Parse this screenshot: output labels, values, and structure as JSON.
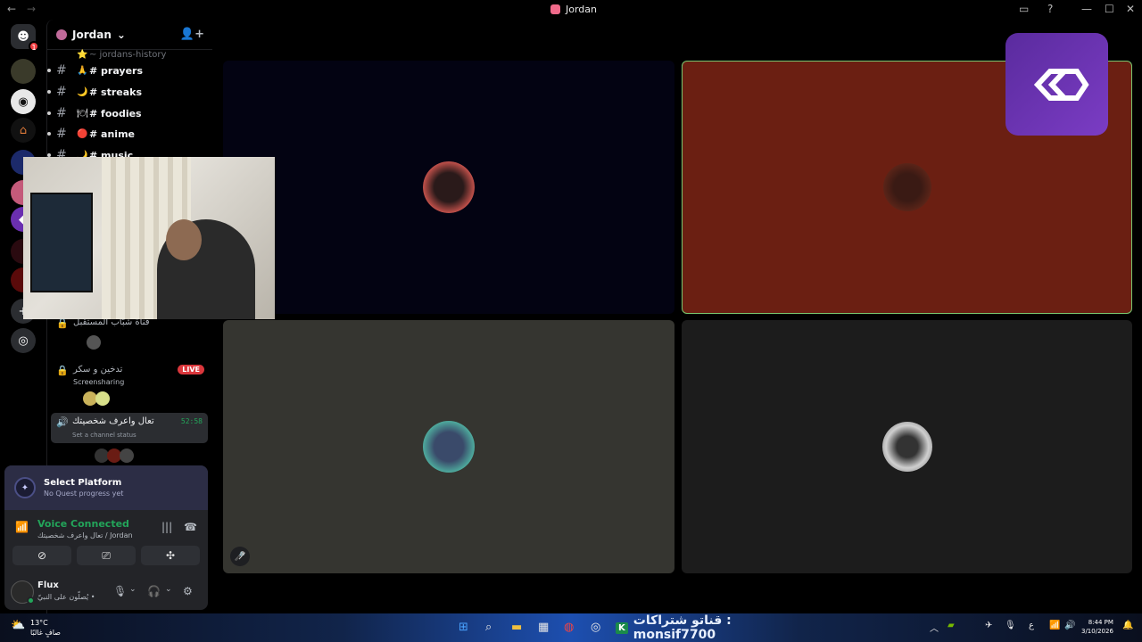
{
  "window": {
    "title": "Jordan",
    "back_glyph": "←",
    "forward_glyph": "→",
    "controls": [
      "▭",
      "?",
      "—",
      "☐",
      "✕"
    ]
  },
  "server_rail": {
    "notification_count": "1",
    "second_badge": "1"
  },
  "server": {
    "name": "Jordan",
    "chevron": "⌄"
  },
  "channels": [
    {
      "emoji": "🙏",
      "name": "# prayers"
    },
    {
      "emoji": "🌙",
      "name": "# streaks"
    },
    {
      "emoji": "🍽",
      "name": "# foodies"
    },
    {
      "emoji": "🔴",
      "name": "# anime"
    },
    {
      "emoji": "🌙",
      "name": "# music"
    }
  ],
  "cutoff_channel": "~ jordans-history",
  "voice_channels": {
    "locked_one": {
      "name": "قناة شبّاب المستقبل"
    },
    "screenshare": {
      "name": "تدخين و سكر",
      "sub": "Screensharing",
      "live_label": "LIVE"
    },
    "active": {
      "name": "تعال واعرف شخصيتك",
      "timer": "52:58",
      "status_prompt": "Set a channel status"
    }
  },
  "quest": {
    "title": "Select Platform",
    "subtitle": "No Quest progress yet"
  },
  "voice_status": {
    "title": "Voice Connected",
    "subtitle": "تعال واعرف شخصيتك / Jordan"
  },
  "user": {
    "name": "Flux",
    "status_text": "يُصلّون على النبيّ •"
  },
  "taskbar": {
    "temperature": "13°C",
    "weather_desc": "صافٍ غالبًا",
    "banner_text": "قناتو شتراكات : monsif7700",
    "time": "8:44 PM",
    "date": "3/10/2026",
    "lang": "ع"
  },
  "colors": {
    "voice_green": "#23a55a",
    "live_red": "#da373c",
    "tile_orange": "#6b1f12",
    "tile_gray": "#353530",
    "tile_dark": "#030312",
    "speaking_border": "#79c66f"
  }
}
